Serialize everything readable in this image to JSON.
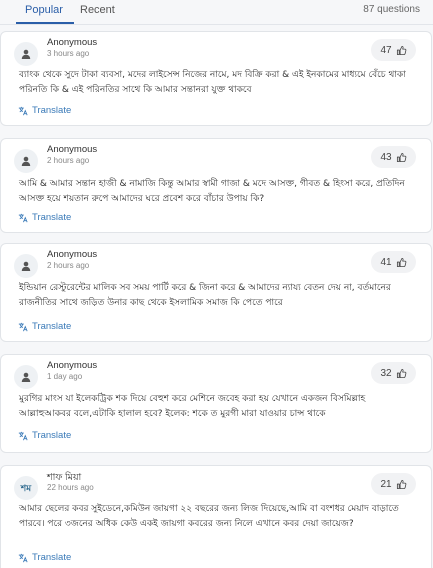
{
  "tabs": [
    {
      "label": "Popular"
    },
    {
      "label": "Recent"
    }
  ],
  "question_count": "87 questions",
  "translate_label": "Translate",
  "questions": [
    {
      "author": "Anonymous",
      "time": "3 hours ago",
      "votes": "47",
      "text": "ব্যাংক থেকে সুদে টাকা ব্যবসা, মদের লাইসেন্স নিজের নামে, মদ বিক্রি করা & এই ইনকামের মাধ্যমে বেঁচে থাকা পরিনতি কি & এই পরিনতির সাথে কি আমার সন্তানরা যুক্ত থাকবে"
    },
    {
      "author": "Anonymous",
      "time": "2 hours ago",
      "votes": "43",
      "text": "আমি & আমার সন্তান হাজী & নামাজি কিন্তু আমার স্বামী গাজা & মদে আসক্ত, গীবত & হিংসা করে, প্রতিদিন আসক্ত হয়ে শয়তান রুপে আমাদের ঘরে প্রবেশ করে বাঁচার উপায় কি?"
    },
    {
      "author": "Anonymous",
      "time": "2 hours ago",
      "votes": "41",
      "text": "ইন্ডিয়ান রেস্টুরেন্টের মালিক সব সময় পার্টি করে & জিনা করে & আমাদের ন্যায্য বেতন দেয় না, বর্তমানের রাজনীতির সাথে জড়িত উনার কাছ থেকে ইসলামিক সমাজ কি পেতে পারে"
    },
    {
      "author": "Anonymous",
      "time": "1 day ago",
      "votes": "32",
      "text": "মুরগির মাংস যা ইলেকট্রিক শক দিয়ে বেহুশ করে মেশিনে জবেহ করা হয় যেখানে একজন বিসমিল্লাহ আল্লাহুআকবর বলে,এটাকি হালাল হবে? ইলেক: শকে ত মুরগী মারা যাওয়ার চান্স থাকে"
    },
    {
      "author": "শাফ মিয়া",
      "initials": "শম",
      "time": "22 hours ago",
      "votes": "21",
      "text": "আমার ছেলের কবর সুইডেনে,কমিউন জায়গা ২২ বছরের জন্য লিজ দিয়েছে,আমি বা বংশধর মেয়াদ বাড়াতে পারবে। পরে ৩জনের অধিক কেউ একই জায়গা কবরের জন্য নিলে এখানে কবর দেয়া জায়েজ?"
    }
  ]
}
